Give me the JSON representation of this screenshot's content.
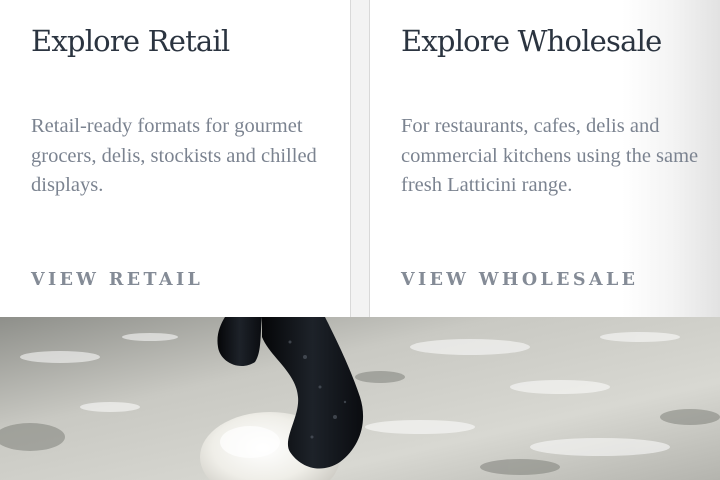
{
  "cards": {
    "retail": {
      "title": "Explore Retail",
      "description": "Retail-ready formats for gourmet grocers, delis, stockists and chilled displays.",
      "link_label": "VIEW RETAIL"
    },
    "wholesale": {
      "title": "Explore Wholesale",
      "description": "For restaurants, cafes, delis and commercial kitchens using the same fresh Latticini range.",
      "link_label": "VIEW WHOLESALE"
    }
  },
  "hero": {
    "image_subject": "gloved-hand-stretching-mozzarella-in-whey"
  },
  "colors": {
    "title": "#2b3440",
    "body_text": "#7b8390",
    "link": "#848b96",
    "divider": "#d9d9d9",
    "glove": "#111418"
  }
}
